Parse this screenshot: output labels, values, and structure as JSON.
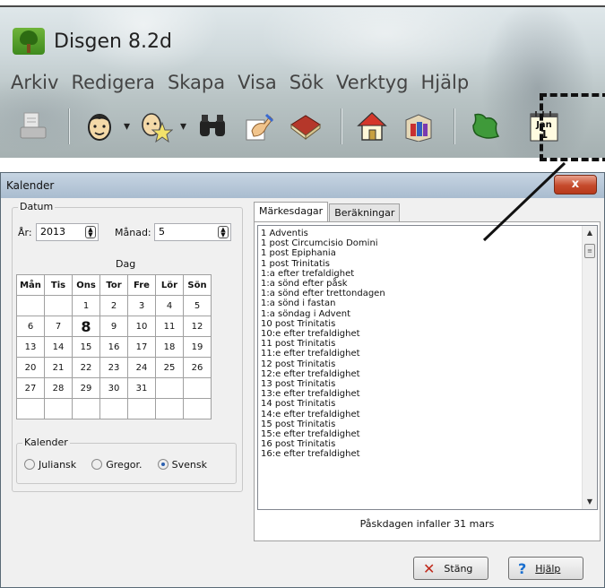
{
  "app": {
    "title": "Disgen 8.2d",
    "menu": [
      "Arkiv",
      "Redigera",
      "Skapa",
      "Visa",
      "Sök",
      "Verktyg",
      "Hjälp"
    ],
    "toolbar_icons": [
      "print-icon",
      "person-icon",
      "person-search-icon",
      "binoculars-icon",
      "hand-pen-icon",
      "book-icon",
      "home-icon",
      "books-icon",
      "map-icon",
      "calendar-icon"
    ],
    "calendar_icon_month": "Jan",
    "calendar_icon_day": "1"
  },
  "dialog": {
    "title": "Kalender",
    "close_label": "x",
    "datum_group": "Datum",
    "year_label": "År:",
    "year_value": "2013",
    "month_label": "Månad:",
    "month_value": "5",
    "day_label": "Dag",
    "weekdays": [
      "Mån",
      "Tis",
      "Ons",
      "Tor",
      "Fre",
      "Lör",
      "Sön"
    ],
    "weeks": [
      [
        "",
        "",
        "1",
        "2",
        "3",
        "4",
        "5"
      ],
      [
        "6",
        "7",
        "8",
        "9",
        "10",
        "11",
        "12"
      ],
      [
        "13",
        "14",
        "15",
        "16",
        "17",
        "18",
        "19"
      ],
      [
        "20",
        "21",
        "22",
        "23",
        "24",
        "25",
        "26"
      ],
      [
        "27",
        "28",
        "29",
        "30",
        "31",
        "",
        ""
      ],
      [
        "",
        "",
        "",
        "",
        "",
        "",
        ""
      ]
    ],
    "selected_day": "8",
    "calendar_group": "Kalender",
    "calendar_options": [
      "Juliansk",
      "Gregor.",
      "Svensk"
    ],
    "calendar_selected": "Svensk",
    "tabs": [
      "Märkesdagar",
      "Beräkningar"
    ],
    "active_tab": "Märkesdagar",
    "list_items": [
      "1 Adventis",
      "1 post Circumcisio Domini",
      "1 post Epiphania",
      "1 post Trinitatis",
      "1:a efter trefaldighet",
      "1:a sönd efter påsk",
      "1:a sönd efter trettondagen",
      "1:a sönd i fastan",
      "1:a söndag i Advent",
      "10 post Trinitatis",
      "10:e efter trefaldighet",
      "11 post Trinitatis",
      "11:e efter trefaldighet",
      "12 post Trinitatis",
      "12:e efter trefaldighet",
      "13 post Trinitatis",
      "13:e efter trefaldighet",
      "14 post Trinitatis",
      "14:e efter trefaldighet",
      "15 post Trinitatis",
      "15:e efter trefaldighet",
      "16 post Trinitatis",
      "16:e efter trefaldighet"
    ],
    "easter_text": "Påskdagen infaller 31 mars",
    "close_button": "Stäng",
    "help_button": "Hjälp"
  },
  "colors": {
    "dialog_bg": "#f0f0f0",
    "close_red": "#c54a2c",
    "close_button_x": "#c0281a",
    "help_blue": "#1a6fd0"
  }
}
